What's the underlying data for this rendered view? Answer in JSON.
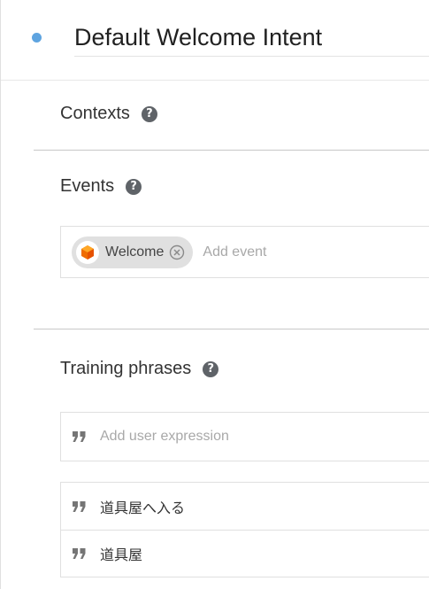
{
  "intent": {
    "title": "Default Welcome Intent"
  },
  "sections": {
    "contexts": {
      "title": "Contexts",
      "help": "?"
    },
    "events": {
      "title": "Events",
      "help": "?"
    },
    "training": {
      "title": "Training phrases",
      "help": "?"
    }
  },
  "events": {
    "chips": [
      {
        "label": "Welcome",
        "icon": "dialogflow-cube-icon"
      }
    ],
    "add_placeholder": "Add event"
  },
  "training_phrases": {
    "add_placeholder": "Add user expression",
    "items": [
      {
        "text": "道具屋へ入る"
      },
      {
        "text": "道具屋"
      }
    ]
  },
  "colors": {
    "status_dot": "#5ea4e0",
    "help_icon": "#5f6368",
    "chip_bg": "#e0e0e0",
    "accent_orange": "#ef6c00"
  }
}
